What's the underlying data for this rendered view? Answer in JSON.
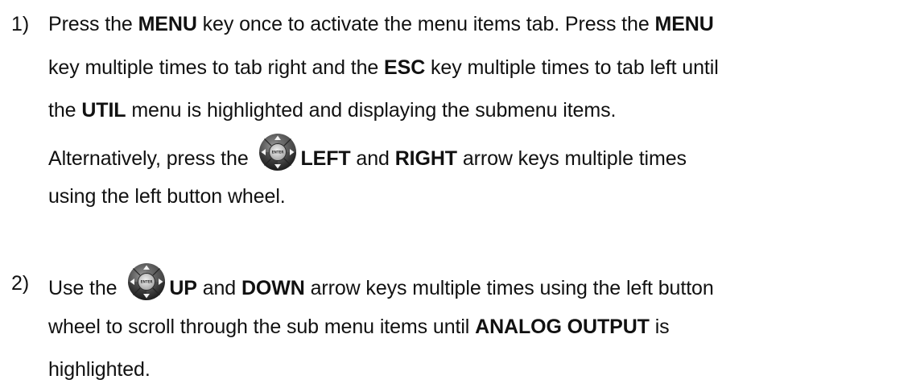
{
  "steps": [
    {
      "number": "1)",
      "lines": [
        [
          "Press the ",
          "MENU",
          " key once to activate the menu items tab.  Press the ",
          "MENU"
        ],
        [
          "key multiple times to tab right and the ",
          "ESC",
          " key multiple times to tab left until"
        ],
        [
          "the ",
          "UTIL",
          " menu is highlighted and displaying the submenu items."
        ],
        [
          "Alternatively, press the ",
          "LEFT",
          " and ",
          "RIGHT",
          " arrow keys multiple times"
        ],
        [
          "using the left button wheel."
        ]
      ]
    },
    {
      "number": "2)",
      "lines": [
        [
          "Use the ",
          "UP",
          " and ",
          "DOWN",
          " arrow keys multiple times using the left button"
        ],
        [
          "wheel to scroll through the sub menu items until ",
          "ANALOG OUTPUT",
          " is"
        ],
        [
          "highlighted."
        ]
      ]
    }
  ],
  "icons": {
    "button_wheel": "four-way-button-wheel-icon",
    "center_label": "ENTER"
  }
}
